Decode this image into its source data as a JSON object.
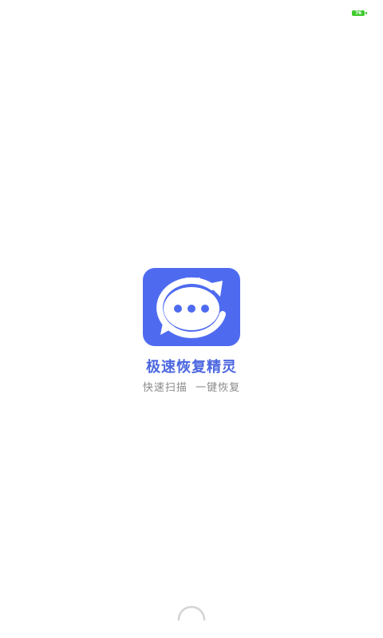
{
  "status_bar": {
    "battery_level": "76",
    "battery_color": "#3fcb2e"
  },
  "splash": {
    "logo_icon": "chat-refresh-icon",
    "logo_color": "#4e6bf0",
    "app_name": "极速恢复精灵",
    "slogan": "快速扫描  一键恢复",
    "accent_color": "#4b66e0"
  },
  "loading": {
    "icon": "loading-spinner-icon"
  }
}
